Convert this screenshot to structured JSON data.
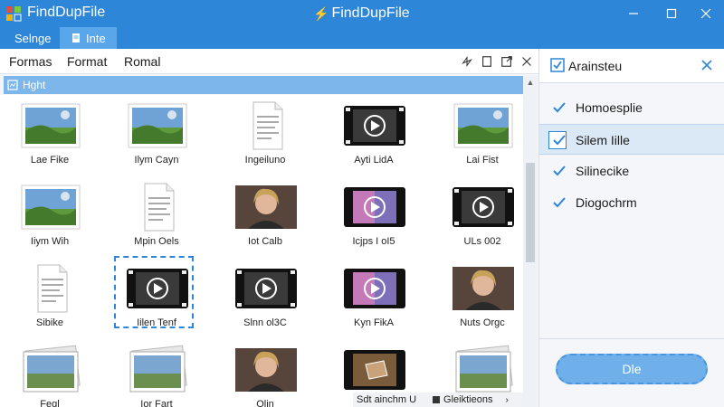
{
  "app": {
    "title": "FindDupFile",
    "center_title": "FindDupFile"
  },
  "tabs": [
    {
      "label": "Selnge"
    },
    {
      "label": "Inte"
    }
  ],
  "menu": {
    "items": [
      {
        "label": "Formas"
      },
      {
        "label": "Format"
      },
      {
        "label": "Romal"
      }
    ]
  },
  "section": {
    "label": "Hght"
  },
  "files": [
    {
      "label": "Lae Fike",
      "kind": "image-landscape"
    },
    {
      "label": "Ilym Cayn",
      "kind": "image-landscape"
    },
    {
      "label": "Ingeiluno",
      "kind": "document"
    },
    {
      "label": "Ayti LidA",
      "kind": "video"
    },
    {
      "label": "Lai Fist",
      "kind": "image-landscape"
    },
    {
      "label": "Iiym Wih",
      "kind": "image-landscape"
    },
    {
      "label": "Mpin Oels",
      "kind": "document"
    },
    {
      "label": "Iot Calb",
      "kind": "photo-portrait"
    },
    {
      "label": "Icjps I oI5",
      "kind": "video-color"
    },
    {
      "label": "ULs 002",
      "kind": "video"
    },
    {
      "label": "Sibike",
      "kind": "document"
    },
    {
      "label": "Iilen Tenf",
      "kind": "video",
      "selected": true
    },
    {
      "label": "Slnn ol3C",
      "kind": "video"
    },
    {
      "label": "Kyn FikA",
      "kind": "video-color"
    },
    {
      "label": "Nuts Orgc",
      "kind": "photo-portrait"
    },
    {
      "label": "Feql",
      "kind": "image-stack"
    },
    {
      "label": "Ior Fart",
      "kind": "image-stack"
    },
    {
      "label": "Olin",
      "kind": "photo-portrait"
    },
    {
      "label": "",
      "kind": "video-brown"
    },
    {
      "label": "",
      "kind": "image-stack"
    }
  ],
  "bottom_strip": {
    "left": "Sdt ainchm U",
    "right": "Gleiktieons"
  },
  "panel": {
    "title": "Arainsteu",
    "options": [
      {
        "label": "Homoesplie",
        "checked": true
      },
      {
        "label": "Silem Iille",
        "checked": true,
        "highlighted": true
      },
      {
        "label": "Silinecike",
        "checked": true
      },
      {
        "label": "Diogochrm",
        "checked": true
      }
    ],
    "done_label": "Dle"
  },
  "colors": {
    "accent": "#2d86d8",
    "titlebar": "#2d86d8",
    "section": "#7cb6ea",
    "button": "#6fb0ea"
  },
  "icons": {
    "app": "app-logo-icon",
    "center": "lightning-icon",
    "minimize": "minimize-icon",
    "maximize": "maximize-icon",
    "close": "close-icon"
  }
}
